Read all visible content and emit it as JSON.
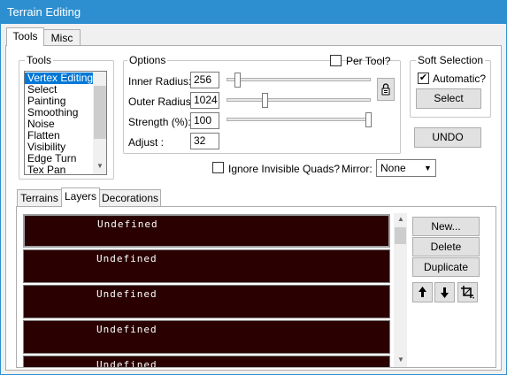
{
  "window": {
    "title": "Terrain Editing"
  },
  "main_tabs": [
    {
      "label": "Tools"
    },
    {
      "label": "Misc"
    }
  ],
  "tools": {
    "group_label": "Tools",
    "items": [
      {
        "label": "Vertex Editing",
        "selected": true
      },
      {
        "label": "Select"
      },
      {
        "label": "Painting"
      },
      {
        "label": "Smoothing"
      },
      {
        "label": "Noise"
      },
      {
        "label": "Flatten"
      },
      {
        "label": "Visibility"
      },
      {
        "label": "Edge Turn"
      },
      {
        "label": "Tex Pan"
      }
    ]
  },
  "options": {
    "group_label": "Options",
    "per_tool_label": "Per Tool?",
    "per_tool_checked": false,
    "inner_radius": {
      "label": "Inner Radius:",
      "value": "256"
    },
    "outer_radius": {
      "label": "Outer Radius:",
      "value": "1024"
    },
    "strength": {
      "label": "Strength (%):",
      "value": "100"
    },
    "adjust": {
      "label": "Adjust :",
      "value": "32"
    }
  },
  "soft_selection": {
    "group_label": "Soft Selection",
    "automatic_label": "Automatic?",
    "automatic_checked": true,
    "select_button": "Select"
  },
  "undo_button": "UNDO",
  "ignore_invisible_label": "Ignore Invisible Quads?",
  "ignore_invisible_checked": false,
  "mirror": {
    "label": "Mirror:",
    "value": "None"
  },
  "sub_tabs": [
    {
      "label": "Terrains"
    },
    {
      "label": "Layers"
    },
    {
      "label": "Decorations"
    }
  ],
  "layers": [
    {
      "name": "Undefined"
    },
    {
      "name": "Undefined"
    },
    {
      "name": "Undefined"
    },
    {
      "name": "Undefined"
    },
    {
      "name": "Undefined"
    }
  ],
  "layer_buttons": {
    "new": "New...",
    "delete": "Delete",
    "duplicate": "Duplicate"
  },
  "icons": {
    "lock": "lock-icon",
    "up": "arrow-up-icon",
    "down": "arrow-down-icon",
    "crop": "crop-icon"
  }
}
